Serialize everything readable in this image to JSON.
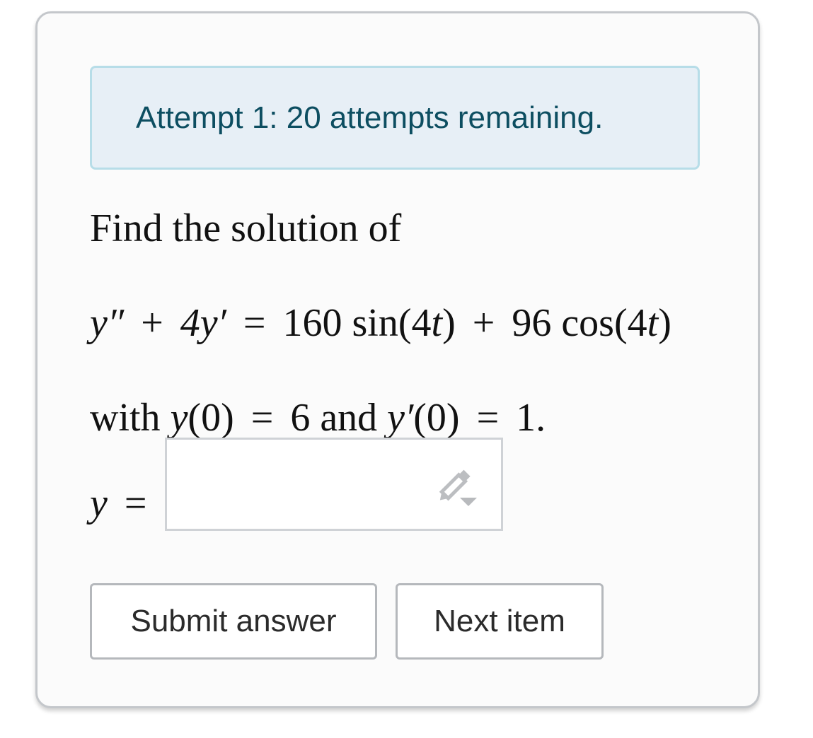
{
  "attempt": {
    "text": "Attempt 1: 20 attempts remaining."
  },
  "question": {
    "prompt": "Find the solution of",
    "equation": {
      "lhs_term1": "y″",
      "plus1": "+",
      "lhs_term2": "4y′",
      "equals": "=",
      "coef1": "160",
      "func1": "sin",
      "arg1_open": "(4",
      "arg1_var": "t",
      "arg1_close": ")",
      "plus2": "+",
      "coef2": "96",
      "func2": "cos",
      "arg2_open": "(4",
      "arg2_var": "t",
      "arg2_close": ")"
    },
    "initial": {
      "with": "with",
      "cond1_var": "y",
      "cond1_arg": "(0)",
      "eq1": "=",
      "cond1_val": "6",
      "and": "and",
      "cond2_var": "y′",
      "cond2_arg": "(0)",
      "eq2": "=",
      "cond2_val": "1."
    }
  },
  "answer": {
    "label_var": "y",
    "label_eq": "=",
    "value": "",
    "placeholder": "",
    "icon": "pencil-dropdown-icon"
  },
  "buttons": {
    "submit_label": "Submit answer",
    "next_label": "Next item"
  },
  "colors": {
    "alert_bg": "#e7eff6",
    "alert_border": "#b7dde8",
    "alert_text": "#0d4e61"
  }
}
